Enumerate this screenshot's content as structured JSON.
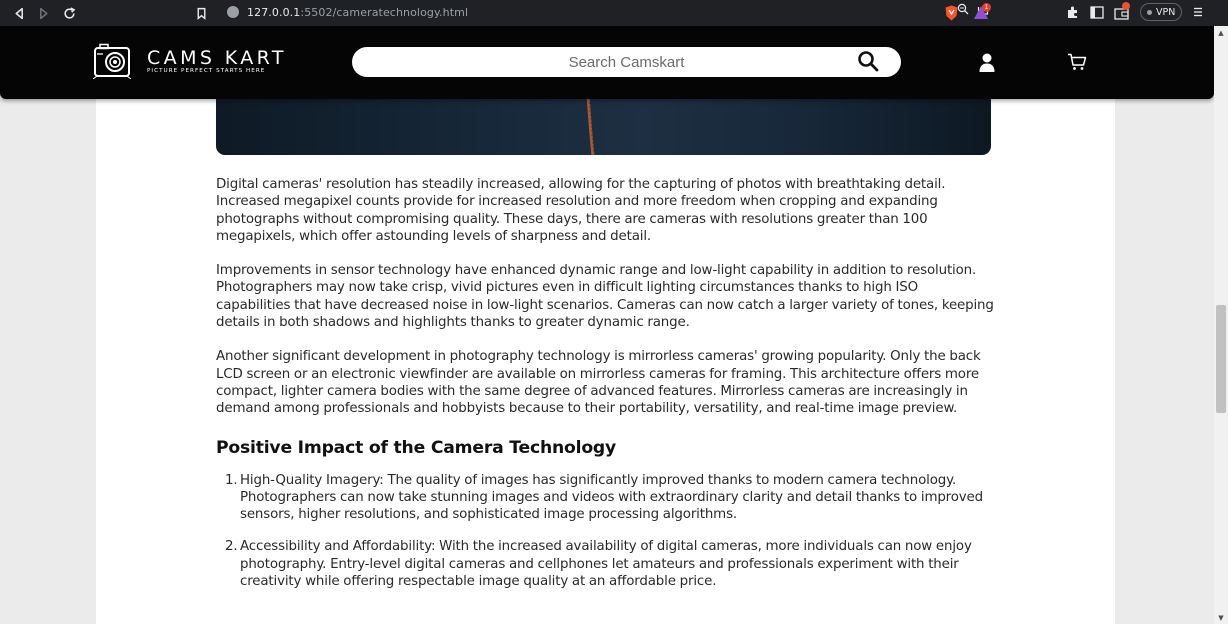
{
  "browser": {
    "url_host": "127.0.0.1",
    "url_path": ":5502/cameratechnology.html",
    "vpn_label": "VPN",
    "badge_count": "1"
  },
  "header": {
    "brand_name": "CAMS KART",
    "brand_tagline": "PICTURE PERFECT STARTS HERE",
    "search_placeholder": "Search Camskart"
  },
  "article": {
    "paragraphs": [
      "Digital cameras' resolution has steadily increased, allowing for the capturing of photos with breathtaking detail. Increased megapixel counts provide for increased resolution and more freedom when cropping and expanding photographs without compromising quality. These days, there are cameras with resolutions greater than 100 megapixels, which offer astounding levels of sharpness and detail.",
      "Improvements in sensor technology have enhanced dynamic range and low-light capability in addition to resolution. Photographers may now take crisp, vivid pictures even in difficult lighting circumstances thanks to high ISO capabilities that have decreased noise in low-light scenarios. Cameras can now catch a larger variety of tones, keeping details in both shadows and highlights thanks to greater dynamic range.",
      "Another significant development in photography technology is mirrorless cameras' growing popularity. Only the back LCD screen or an electronic viewfinder are available on mirrorless cameras for framing. This architecture offers more compact, lighter camera bodies with the same degree of advanced features. Mirrorless cameras are increasingly in demand among professionals and hobbyists because to their portability, versatility, and real-time image preview."
    ],
    "section_title": "Positive Impact of the Camera Technology",
    "impact_items": [
      {
        "number": "1.",
        "text": "High-Quality Imagery: The quality of images has significantly improved thanks to modern camera technology. Photographers can now take stunning images and videos with extraordinary clarity and detail thanks to improved sensors, higher resolutions, and sophisticated image processing algorithms."
      },
      {
        "number": "2.",
        "text": "Accessibility and Affordability: With the increased availability of digital cameras, more individuals can now enjoy photography. Entry-level digital cameras and cellphones let amateurs and professionals experiment with their creativity while offering respectable image quality at an affordable price."
      }
    ]
  },
  "colors": {
    "header_bg": "#050505",
    "browser_bg": "#202124",
    "page_bg": "#ebebeb",
    "text": "#2a2a2a"
  },
  "icons": [
    "back-icon",
    "forward-icon",
    "reload-icon",
    "bookmark-icon",
    "info-icon",
    "zoom-icon",
    "share-icon",
    "brave-shield-icon",
    "brave-rewards-icon",
    "extensions-icon",
    "sidebar-icon",
    "wallet-icon",
    "menu-icon",
    "camera-logo-icon",
    "search-icon",
    "user-icon",
    "cart-icon"
  ]
}
